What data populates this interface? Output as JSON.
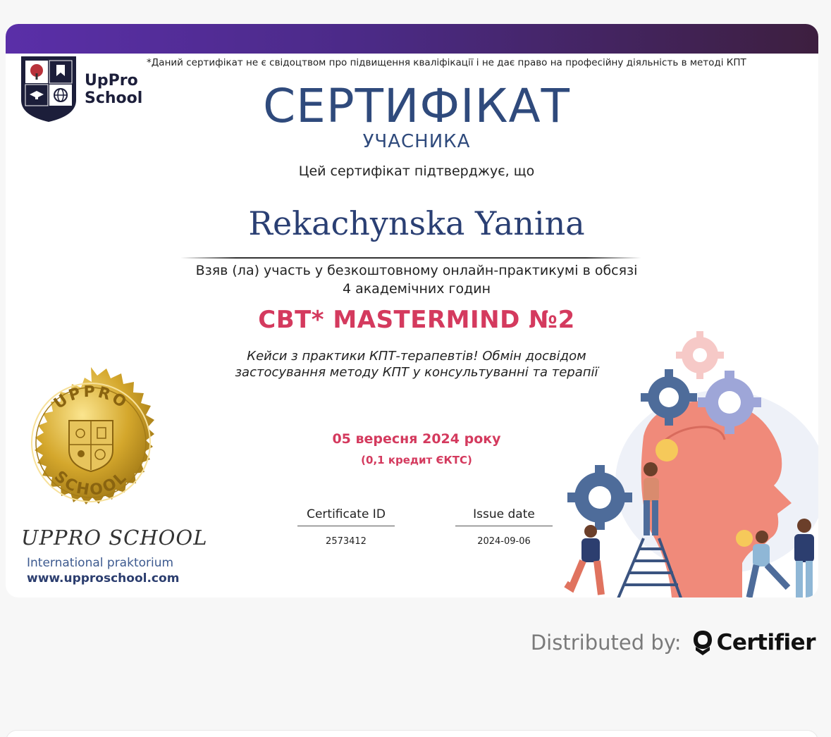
{
  "certificate": {
    "disclaimer": "*Даний сертифікат не є свідоцтвом про підвищення кваліфікації і не дає право на професійну діяльність в методі КПТ",
    "logo_text_line1": "UpPro",
    "logo_text_line2": "School",
    "title": "СЕРТИФІКАТ",
    "subtitle": "УЧАСНИКА",
    "confirm_text": "Цей сертифікат підтверджує, що",
    "recipient_name": "Rekachynska Yanina",
    "participation_line1": "Взяв (ла) участь у безкоштовному онлайн-практикумі в обсязі",
    "participation_line2": "4 академічних годин",
    "course_title": "CBT* MASTERMIND №2",
    "description_line1": "Кейси з практики КПТ-терапевтів! Обмін досвідом",
    "description_line2": "застосування методу КПТ у консультуванні та терапії",
    "event_date": "05 вересня 2024 року",
    "credits": "(0,1  кредит ЄКТС)",
    "certificate_id_label": "Certificate ID",
    "certificate_id": "2573412",
    "issue_date_label": "Issue date",
    "issue_date": "2024-09-06",
    "seal_text_top": "UPPRO",
    "seal_text_bottom": "SCHOOL",
    "school_name": "UPPRO SCHOOL",
    "school_subtitle": "International praktorium",
    "school_website": "www.upproschool.com"
  },
  "footer": {
    "distributed_label": "Distributed by:",
    "distributor_name": "Certifier"
  },
  "colors": {
    "header_gradient_start": "#5a2fa8",
    "header_gradient_end": "#3d1f3f",
    "title_blue": "#2f4a7c",
    "accent_pink": "#d43a5e",
    "gold": "#d4a72c"
  },
  "icons": {
    "logo": "shield-logo-icon",
    "seal": "gold-seal-icon",
    "distributor_logo": "certifier-logo-icon",
    "illustration": "head-gears-illustration"
  }
}
